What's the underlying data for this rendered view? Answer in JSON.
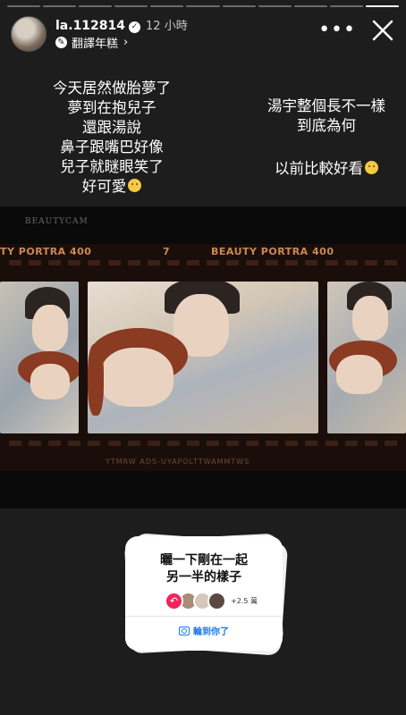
{
  "header": {
    "username": "la.112814",
    "time": "12 小時",
    "translate": "翻譯年糕"
  },
  "overlay_text": {
    "left_lines": [
      "今天居然做胎夢了",
      "夢到在抱兒子",
      "還跟湯說",
      "鼻子跟嘴巴好像",
      "兒子就瞇眼笑了",
      "好可愛"
    ],
    "right_lines_1": [
      "湯宇整個長不一樣",
      "到底為何"
    ],
    "right_line_2": "以前比較好看"
  },
  "photo": {
    "app_watermark": "BEAUTYCAM",
    "film_label_left": "TY PORTRA 400",
    "frame_number": "7",
    "film_label_right": "BEAUTY PORTRA 400",
    "film_bottom_text": "YTMRW  ADS-UYAPOLTTWAMMTWS"
  },
  "sticker": {
    "title_line1": "曬一下剛在一起",
    "title_line2": "另一半的樣子",
    "count": "+2.5 萬",
    "action": "輪到你了"
  }
}
